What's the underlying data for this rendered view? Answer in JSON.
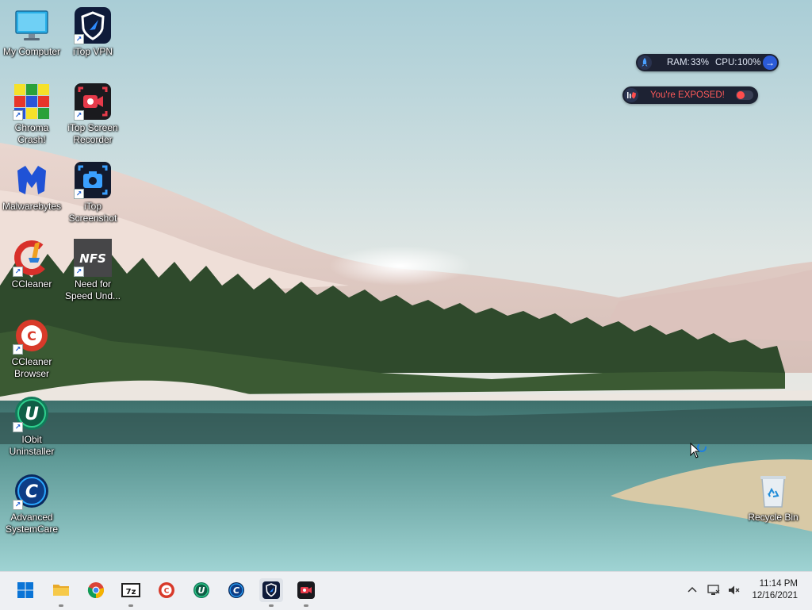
{
  "desktop": {
    "icons": [
      {
        "label": "My Computer",
        "icon": "monitor-icon",
        "shortcut": false
      },
      {
        "label": "iTop VPN",
        "icon": "itop-vpn-icon",
        "shortcut": true
      },
      {
        "label": "Chroma Crash!",
        "icon": "chroma-crash-icon",
        "shortcut": true
      },
      {
        "label": "iTop Screen Recorder",
        "icon": "itop-screen-recorder-icon",
        "shortcut": true
      },
      {
        "label": "Malwarebytes",
        "icon": "malwarebytes-icon",
        "shortcut": false
      },
      {
        "label": "iTop Screenshot",
        "icon": "itop-screenshot-icon",
        "shortcut": true
      },
      {
        "label": "CCleaner",
        "icon": "ccleaner-icon",
        "shortcut": true
      },
      {
        "label": "Need for Speed Und...",
        "icon": "need-for-speed-icon",
        "shortcut": true
      },
      {
        "label": "CCleaner Browser",
        "icon": "ccleaner-browser-icon",
        "shortcut": true
      },
      {
        "label": "IObit Uninstaller",
        "icon": "iobit-uninstaller-icon",
        "shortcut": true
      },
      {
        "label": "Advanced SystemCare",
        "icon": "advanced-systemcare-icon",
        "shortcut": true
      },
      {
        "label": "Recycle Bin",
        "icon": "recycle-bin-icon",
        "shortcut": false
      }
    ]
  },
  "widgets": {
    "performance": {
      "ram_label": "RAM:",
      "ram_value": "33%",
      "cpu_label": "CPU:",
      "cpu_value": "100%"
    },
    "vpn_status": {
      "text": "You're EXPOSED!",
      "color": "#ff4d4d"
    }
  },
  "taskbar": {
    "apps": [
      {
        "name": "start-button",
        "icon": "windows-logo-icon",
        "running": false
      },
      {
        "name": "file-explorer",
        "icon": "folder-icon",
        "running": true
      },
      {
        "name": "chrome",
        "icon": "chrome-icon",
        "running": false
      },
      {
        "name": "7zip",
        "icon": "7zip-icon",
        "label": "7z",
        "running": true
      },
      {
        "name": "ccleaner-browser",
        "icon": "ccleaner-browser-icon",
        "running": false
      },
      {
        "name": "iobit-uninstaller",
        "icon": "iobit-uninstaller-icon",
        "running": false
      },
      {
        "name": "advanced-systemcare",
        "icon": "advanced-systemcare-icon",
        "running": false
      },
      {
        "name": "itop-vpn",
        "icon": "itop-vpn-icon",
        "running": true
      },
      {
        "name": "itop-screen-recorder",
        "icon": "itop-screen-recorder-icon",
        "running": true
      }
    ],
    "tray": {
      "time": "11:14 PM",
      "date": "12/16/2021"
    }
  },
  "colors": {
    "accent": "#0067c0",
    "widget_bg": "#1d2233",
    "exposed": "#ff4d4d"
  }
}
